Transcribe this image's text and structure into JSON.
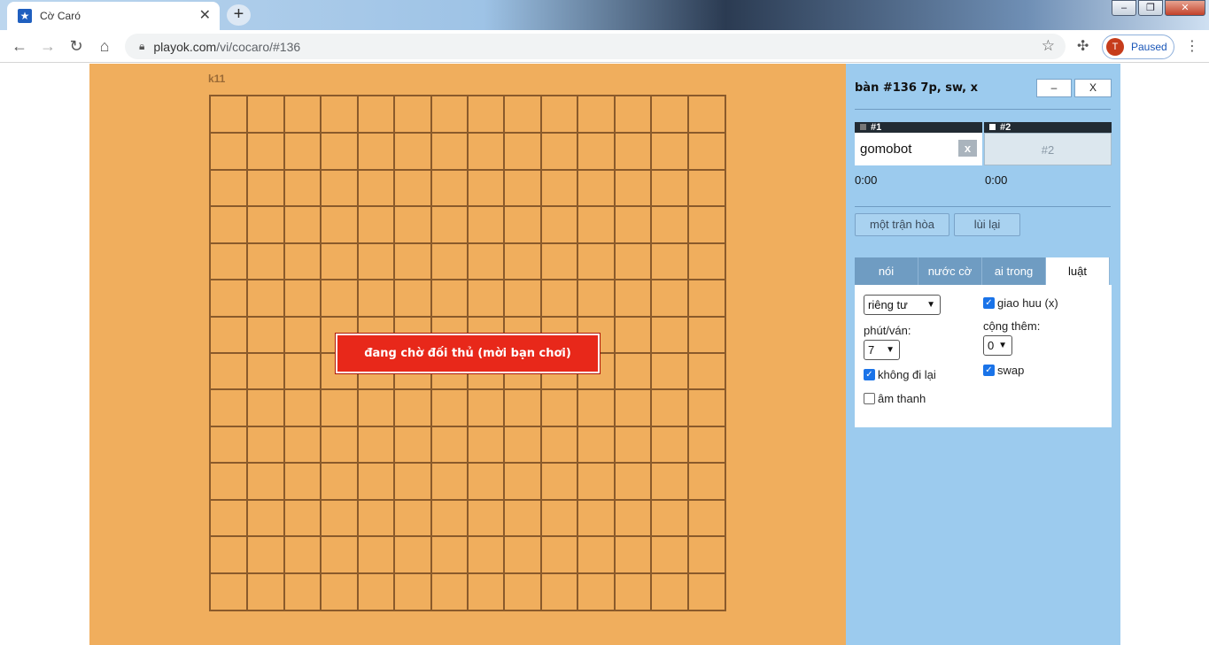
{
  "browser": {
    "tab_title": "Cờ Caró",
    "tab_close": "✕",
    "new_tab": "+",
    "url_host": "playok.com",
    "url_path": "/vi/cocaro/#136",
    "profile_initial": "T",
    "profile_status": "Paused",
    "window": {
      "minimize": "–",
      "maximize": "❐",
      "close": "✕"
    }
  },
  "board": {
    "label": "k11",
    "rows": 14,
    "cols": 14,
    "waiting_text": "đang chờ đối thủ (mời bạn chơi)",
    "colors": {
      "background": "#f0ae5d",
      "lines": "#8a5a2b",
      "waiting": "#e8281a"
    }
  },
  "side": {
    "title": "bàn #136   7p, sw, x",
    "minimize_label": "–",
    "close_label": "X",
    "players": [
      {
        "slot": "#1",
        "name": "gomobot",
        "kick": "x",
        "time": "0:00"
      },
      {
        "slot": "#2",
        "name": "#2",
        "time": "0:00"
      }
    ],
    "actions": {
      "draw": "một trận hòa",
      "undo": "lùi lại"
    },
    "tabs": [
      "nói",
      "nước cờ",
      "ai trong",
      "luật"
    ],
    "rules": {
      "privacy_select": "riêng tư",
      "minutes_label": "phút/ván:",
      "minutes_value": "7",
      "no_undo": "không đi lại",
      "sound": "âm thanh",
      "friendly": "giao huu (x)",
      "increment_label": "cộng thêm:",
      "increment_value": "0",
      "swap": "swap"
    },
    "colors": {
      "background": "#9ccbee",
      "tab": "#6f9cc2"
    }
  }
}
